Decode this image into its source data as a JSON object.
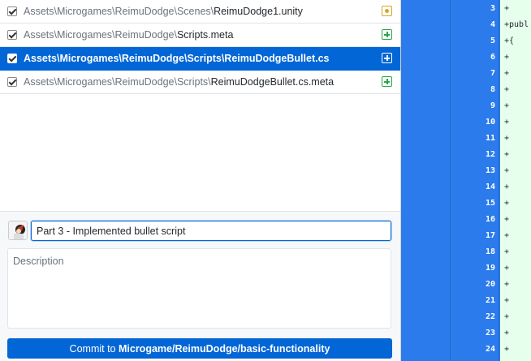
{
  "files": [
    {
      "dir": "Assets\\Microgames\\ReimuDodge\\Scenes\\",
      "name": "ReimuDodge1.unity",
      "checked": true,
      "status": "modified",
      "selected": false
    },
    {
      "dir": "Assets\\Microgames\\ReimuDodge\\",
      "name": "Scripts.meta",
      "checked": true,
      "status": "added",
      "selected": false
    },
    {
      "dir": "Assets\\Microgames\\ReimuDodge\\Scripts\\",
      "name": "ReimuDodgeBullet.cs",
      "checked": true,
      "status": "added",
      "selected": true
    },
    {
      "dir": "Assets\\Microgames\\ReimuDodge\\Scripts\\",
      "name": "ReimuDodgeBullet.cs.meta",
      "checked": true,
      "status": "added",
      "selected": false
    }
  ],
  "commit": {
    "summary": "Part 3 - Implemented bullet script",
    "description_placeholder": "Description",
    "button_prefix": "Commit to ",
    "branch": "Microgame/ReimuDodge/basic-functionality"
  },
  "diff": {
    "lines": [
      {
        "num": "3",
        "code": "+"
      },
      {
        "num": "4",
        "code": "+publ"
      },
      {
        "num": "5",
        "code": "+{"
      },
      {
        "num": "6",
        "code": "+"
      },
      {
        "num": "7",
        "code": "+"
      },
      {
        "num": "8",
        "code": "+"
      },
      {
        "num": "9",
        "code": "+"
      },
      {
        "num": "10",
        "code": "+"
      },
      {
        "num": "11",
        "code": "+"
      },
      {
        "num": "12",
        "code": "+"
      },
      {
        "num": "13",
        "code": "+"
      },
      {
        "num": "14",
        "code": "+"
      },
      {
        "num": "15",
        "code": "+"
      },
      {
        "num": "16",
        "code": "+"
      },
      {
        "num": "17",
        "code": "+"
      },
      {
        "num": "18",
        "code": "+"
      },
      {
        "num": "19",
        "code": "+"
      },
      {
        "num": "20",
        "code": "+"
      },
      {
        "num": "21",
        "code": "+"
      },
      {
        "num": "22",
        "code": "+"
      },
      {
        "num": "23",
        "code": "+"
      },
      {
        "num": "24",
        "code": "+"
      }
    ]
  },
  "colors": {
    "accent": "#0366d6",
    "diff_gutter": "#2b7bec",
    "added_bg": "#e6ffed",
    "modified": "#d4a72c",
    "added": "#28a745"
  }
}
